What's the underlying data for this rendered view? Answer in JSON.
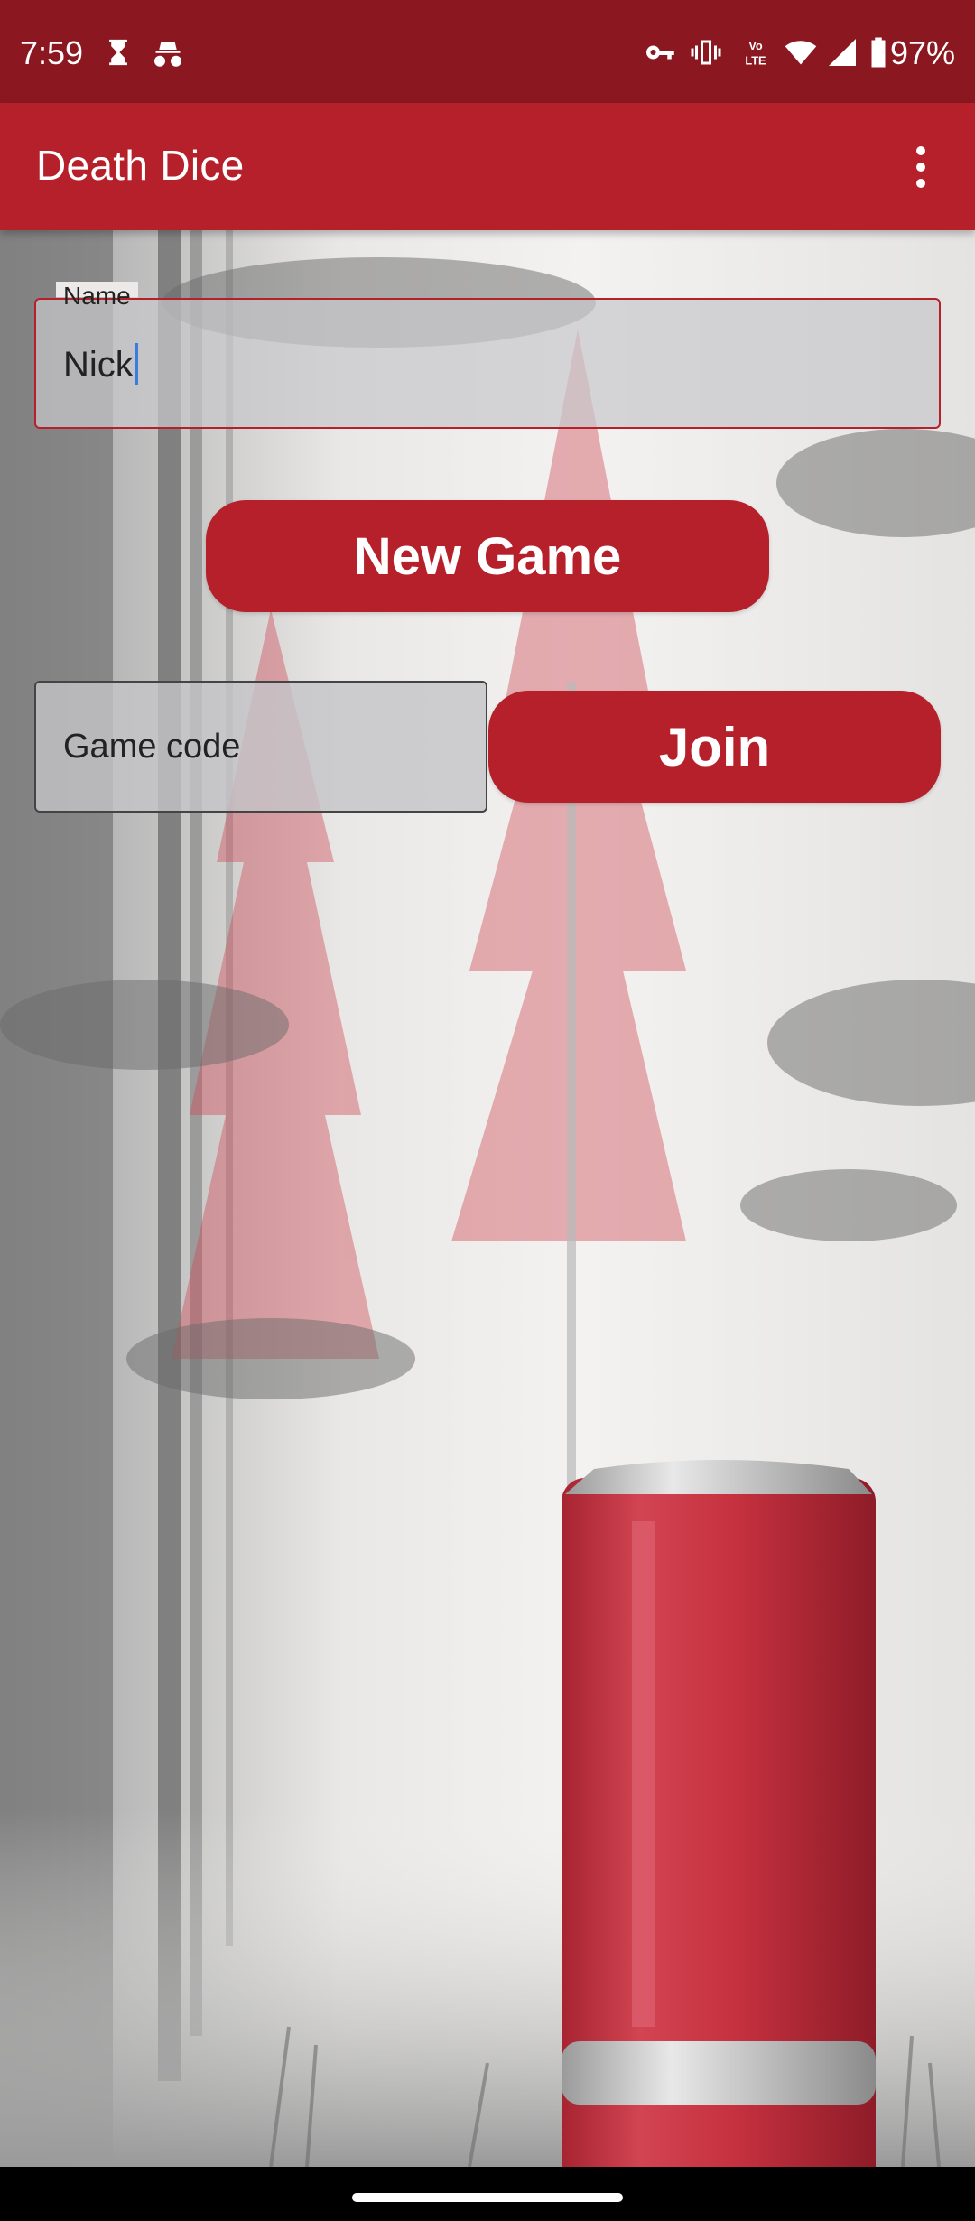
{
  "status_bar": {
    "time": "7:59",
    "battery": "97%",
    "icons": [
      "hourglass-icon",
      "incognito-icon",
      "key-icon",
      "vibrate-icon",
      "volte-icon",
      "wifi-icon",
      "signal-icon",
      "battery-icon"
    ],
    "volte_text": "VoLTE"
  },
  "app_bar": {
    "title": "Death Dice",
    "menu_icon": "more-vert-icon"
  },
  "form": {
    "name_label": "Name",
    "name_value": "Nick",
    "new_game_label": "New Game",
    "game_code_placeholder": "Game code",
    "join_label": "Join"
  },
  "colors": {
    "status_bar": "#8b1820",
    "primary": "#b5202a",
    "text_on_primary": "#ffffff"
  }
}
